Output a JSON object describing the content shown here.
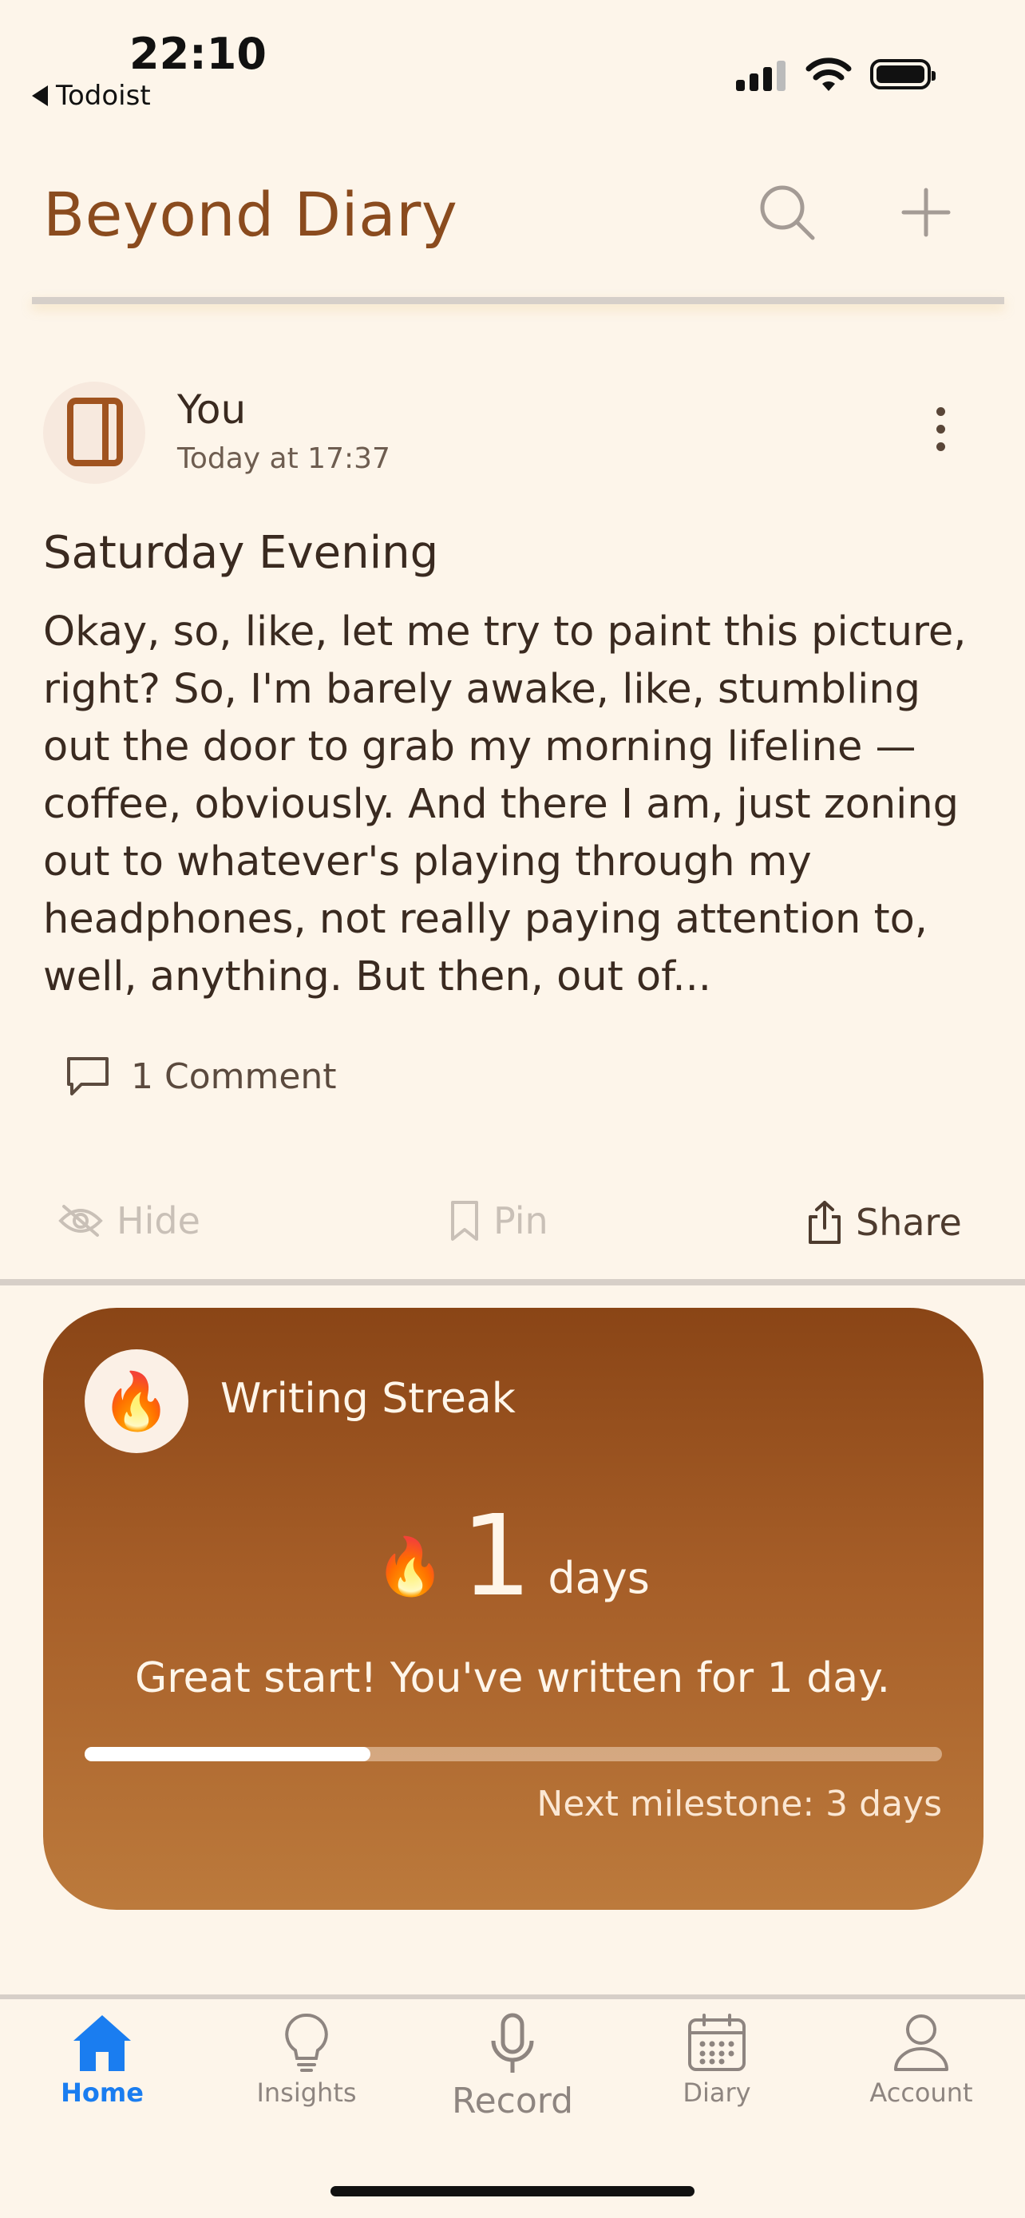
{
  "status_bar": {
    "time": "22:10",
    "back_app": "Todoist"
  },
  "header": {
    "title": "Beyond Diary"
  },
  "entry": {
    "author": "You",
    "time": "Today at 17:37",
    "title": "Saturday Evening",
    "body": "Okay, so, like, let me try to paint this picture, right? So, I'm barely awake, like, stumbling out the door to grab my morning lifeline — coffee, obviously. And there I am, just zoning out to whatever's playing through my headphones, not really paying attention to, well, anything. But then, out of...",
    "comments": "1 Comment"
  },
  "actions": {
    "hide": "Hide",
    "pin": "Pin",
    "share": "Share"
  },
  "streak": {
    "title": "Writing Streak",
    "count": "1",
    "unit": "days",
    "message": "Great start! You've written for 1 day.",
    "progress_fraction": 0.333,
    "milestone": "Next milestone: 3 days",
    "icon": "fire-icon"
  },
  "tabs": [
    {
      "label": "Home",
      "icon": "house-icon",
      "active": true
    },
    {
      "label": "Insights",
      "icon": "lightbulb-icon",
      "active": false
    },
    {
      "label": "Record",
      "icon": "microphone-icon",
      "active": false
    },
    {
      "label": "Diary",
      "icon": "calendar-icon",
      "active": false
    },
    {
      "label": "Account",
      "icon": "person-icon",
      "active": false
    }
  ],
  "colors": {
    "background": "#fdf5ea",
    "brand": "#8a4b1e",
    "accent_tab": "#1a7df0",
    "card_top": "#8a4516",
    "card_bottom": "#bc7a3c"
  }
}
